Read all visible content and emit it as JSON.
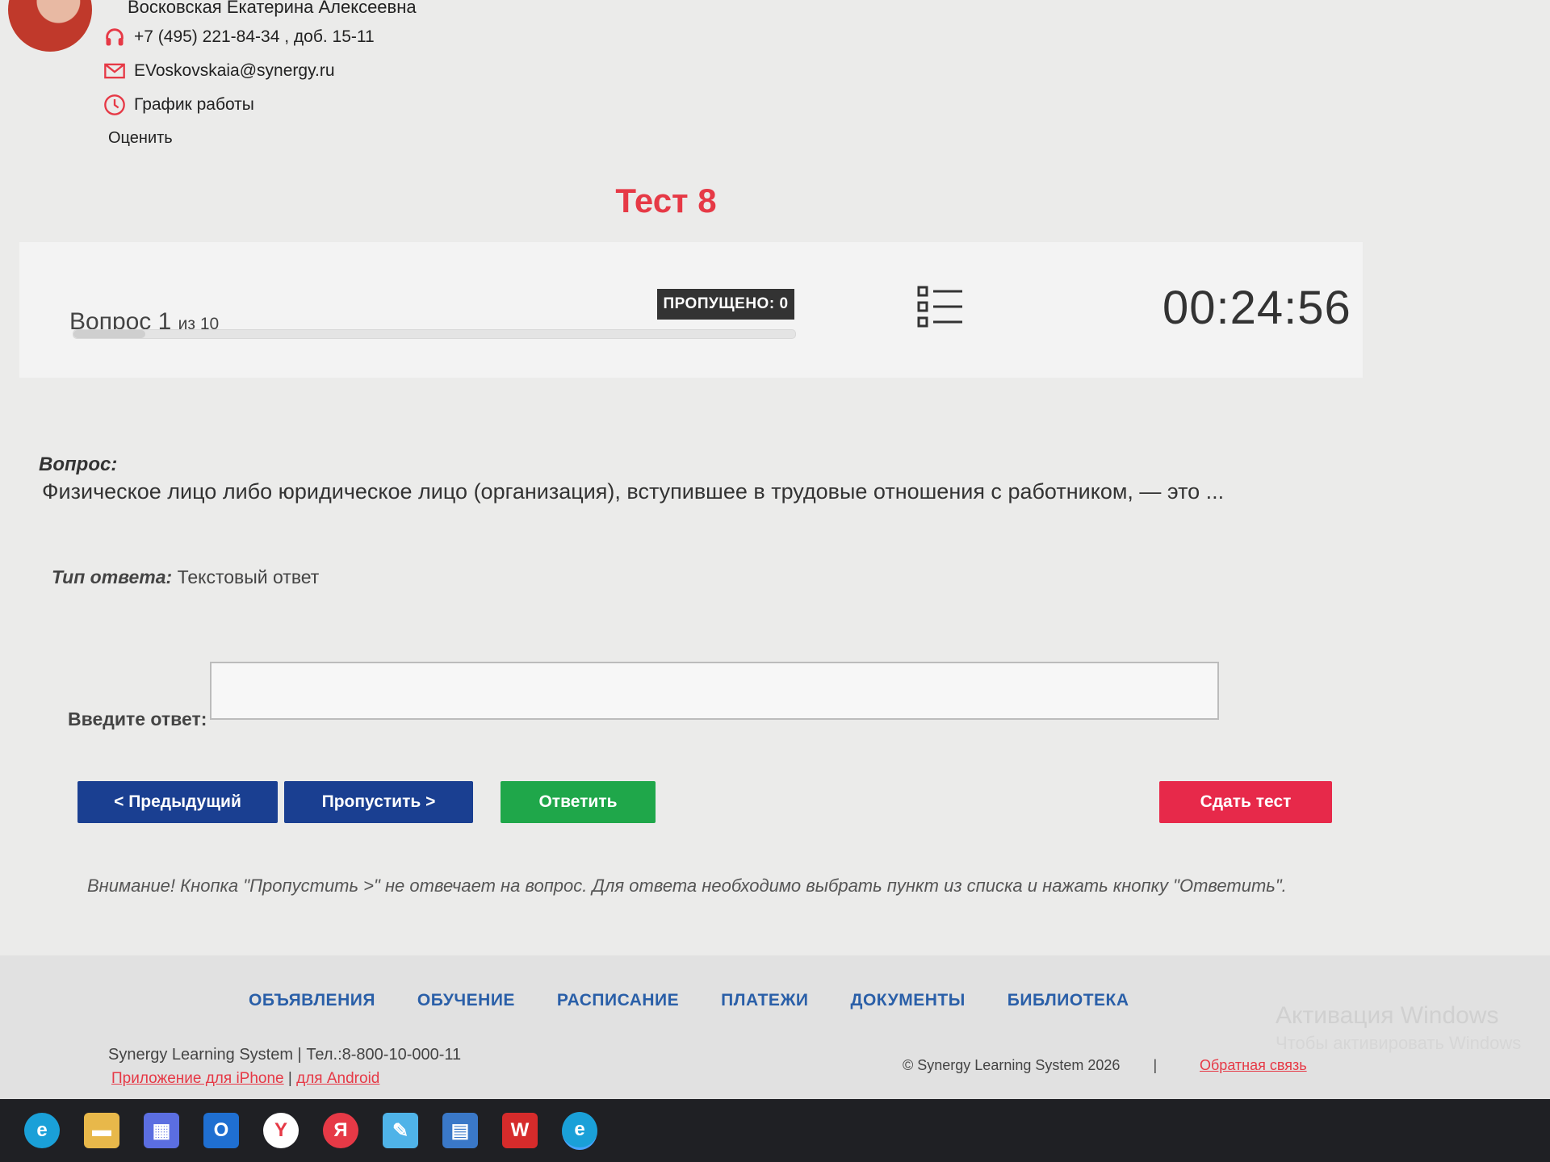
{
  "curator": {
    "name": "Восковская Екатерина Алексеевна",
    "phone": "+7 (495) 221-84-34 , доб. 15-11",
    "email": "EVoskovskaia@synergy.ru",
    "schedule": "График работы",
    "rate": "Оценить"
  },
  "page_title": "Тест 8",
  "progress": {
    "question_label": "Вопрос 1",
    "question_total": "из 10",
    "skipped": "ПРОПУЩЕНО: 0",
    "timer": "00:24:56",
    "progress_fraction": 0.1
  },
  "question": {
    "label": "Вопрос:",
    "text": "Физическое лицо либо юридическое лицо (организация), вступившее в трудовые отношения с работником, — это ...",
    "answer_type_label": "Тип ответа:",
    "answer_type_value": "Текстовый ответ",
    "answer_label": "Введите ответ:"
  },
  "buttons": {
    "prev": "< Предыдущий",
    "skip": "Пропустить >",
    "answer": "Ответить",
    "submit": "Сдать тест"
  },
  "warning": "Внимание! Кнопка \"Пропустить >\" не отвечает на вопрос. Для ответа необходимо выбрать пункт из списка и нажать кнопку \"Ответить\".",
  "footer": {
    "nav": [
      "ОБЪЯВЛЕНИЯ",
      "ОБУЧЕНИЕ",
      "РАСПИСАНИЕ",
      "ПЛАТЕЖИ",
      "ДОКУМЕНТЫ",
      "БИБЛИОТЕКА"
    ],
    "info": "Synergy Learning System  |  Тел.:8-800-10-000-11",
    "iphone": "Приложение для iPhone",
    "android": "для Android",
    "copyright": "© Synergy Learning System 2026",
    "separator": "|",
    "feedback": "Обратная связь",
    "watermark": "Активация Windows",
    "watermark_sub": "Чтобы активировать Windows"
  },
  "colors": {
    "accent_red": "#e63946",
    "nav_blue": "#1a3f91",
    "answer_green": "#1fa74a",
    "submit_red": "#e7294a"
  },
  "taskbar_icons": [
    "edge-icon",
    "file-explorer-icon",
    "store-icon",
    "outlook-icon",
    "yandex-browser-icon",
    "yandex-icon",
    "notepad-icon",
    "calculator-icon",
    "wps-office-icon",
    "edge-icon"
  ]
}
